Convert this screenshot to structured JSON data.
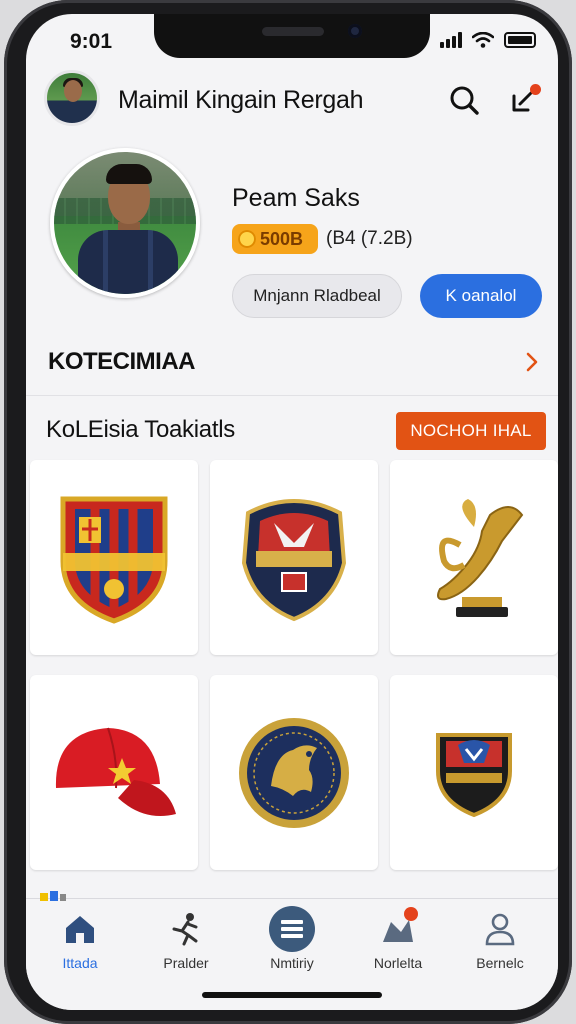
{
  "status_bar": {
    "time": "9:01"
  },
  "header": {
    "title": "Maimil Kingain Rergah"
  },
  "profile": {
    "name": "Peam Saks",
    "coins": "500B",
    "rating": "(B4 (7.2B)",
    "secondary_button": "Mnjann Rladbeal",
    "primary_button": "K oanalol"
  },
  "section": {
    "title": "KOTECIMIAA"
  },
  "collection": {
    "title": "KoLEisia Toakiatls",
    "action": "NOCHOH IHAL",
    "items": [
      {
        "icon": "crest-shield-icon"
      },
      {
        "icon": "club-badge-icon"
      },
      {
        "icon": "trophy-icon"
      },
      {
        "icon": "cap-icon"
      },
      {
        "icon": "eagle-medal-icon"
      },
      {
        "icon": "mini-shield-icon"
      }
    ]
  },
  "tabs": [
    {
      "label": "Ittada",
      "icon": "home-icon",
      "active": true
    },
    {
      "label": "Pralder",
      "icon": "player-icon",
      "active": false
    },
    {
      "label": "Nmtiriy",
      "icon": "list-icon",
      "active": false
    },
    {
      "label": "Norlelta",
      "icon": "notification-icon",
      "active": false
    },
    {
      "label": "Bernelc",
      "icon": "profile-icon",
      "active": false
    }
  ],
  "colors": {
    "accent": "#2b6fe0",
    "orange": "#e25314",
    "notification": "#e4421c",
    "coin": "#f6a41a"
  }
}
